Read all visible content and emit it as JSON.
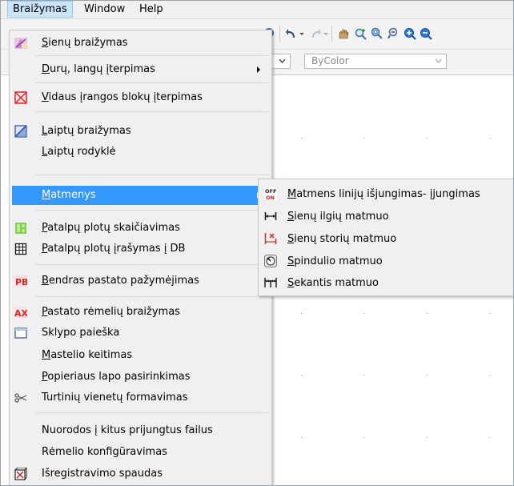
{
  "menubar": {
    "items": [
      {
        "label": "Braižymas"
      },
      {
        "label": "Window"
      },
      {
        "label": "Help"
      }
    ]
  },
  "toolbar": {
    "color_dropdown": "ByColor"
  },
  "menu": {
    "items": [
      {
        "key": "S",
        "rest": "ienų braižymas",
        "icon": "wall-drawing-icon"
      },
      {
        "key": "D",
        "rest": "urų, langų įterpimas",
        "icon": null,
        "submenu": true
      },
      {
        "key": "V",
        "rest": "idaus įrangos blokų įterpimas",
        "icon": "equipment-block-icon"
      },
      {
        "key": "L",
        "rest": "aiptų braižymas",
        "icon": "stairs-icon"
      },
      {
        "key": "L",
        "rest": "aiptų rodyklė",
        "icon": null
      },
      {
        "key": "M",
        "rest": "atmenys",
        "icon": null,
        "submenu": true,
        "highlighted": true
      },
      {
        "key": "P",
        "rest": "atalpų plotų skaičiavimas",
        "icon": "area-calc-icon"
      },
      {
        "key": "P",
        "rest": "atalpų plotų įrašymas į DB",
        "icon": "grid-table-icon"
      },
      {
        "key": "B",
        "rest": "endras pastato pažymėjimas",
        "icon": "pb-icon"
      },
      {
        "key": "P",
        "rest": "astato rėmelių braižymas",
        "icon": "ax-icon"
      },
      {
        "key": "",
        "rest": "Sklypo paieška",
        "icon": "window-icon"
      },
      {
        "key": "M",
        "rest": "astelio keitimas",
        "icon": null
      },
      {
        "key": "P",
        "rest": "opieriaus lapo pasirinkimas",
        "icon": null
      },
      {
        "key": "",
        "rest": "Turtinių vienetų formavimas",
        "icon": "scissors-icon"
      },
      {
        "key": "",
        "rest": "Nuorodos į kitus prijungtus failus",
        "icon": null
      },
      {
        "key": "",
        "rest": "Rėmelio konfigūravimas",
        "icon": null
      },
      {
        "key": "",
        "rest": "Išregistravimo spaudas",
        "icon": "stamp-icon"
      }
    ]
  },
  "submenu": {
    "items": [
      {
        "key": "M",
        "rest": "atmens linijų išjungimas- įjungimas",
        "icon": "off-on-icon"
      },
      {
        "key": "S",
        "rest": "ienų ilgių matmuo",
        "icon": "linear-dimension-icon"
      },
      {
        "key": "S",
        "rest": "ienų storių matmuo",
        "icon": "thickness-dimension-icon"
      },
      {
        "key": "S",
        "rest": "pindulio matmuo",
        "icon": "radius-dimension-icon"
      },
      {
        "key": "S",
        "rest": "ekantis matmuo",
        "icon": "continue-dimension-icon"
      }
    ]
  },
  "colors": {
    "highlight": "#3399ff",
    "menu_bg": "#f0f0f0",
    "menubar_active": "#cce4f7"
  }
}
